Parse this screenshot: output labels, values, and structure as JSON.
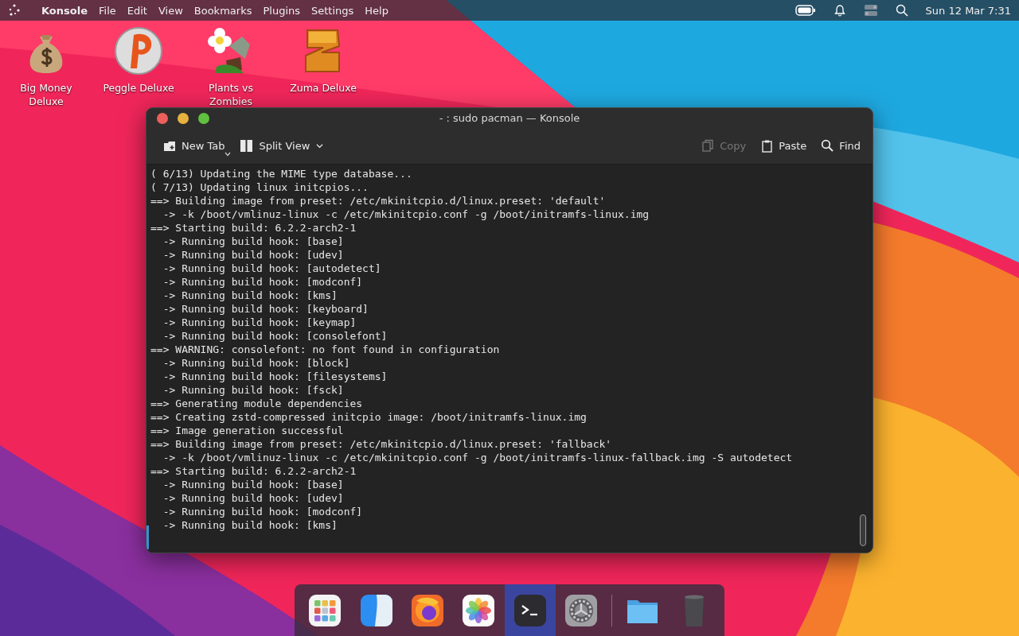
{
  "menu_bar": {
    "app_name": "Konsole",
    "menus": [
      "File",
      "Edit",
      "View",
      "Bookmarks",
      "Plugins",
      "Settings",
      "Help"
    ],
    "clock": "Sun 12 Mar 7:31"
  },
  "desktop_icons": [
    {
      "kind": "moneybag",
      "label": "Big Money Deluxe"
    },
    {
      "kind": "orb",
      "label": "Peggle Deluxe"
    },
    {
      "kind": "flower",
      "label": "Plants vs Zombies"
    },
    {
      "kind": "block",
      "label": "Zuma Deluxe"
    }
  ],
  "window": {
    "title": "- : sudo pacman — Konsole",
    "toolbar": [
      {
        "kind": "new-tab",
        "label": "New Tab",
        "disabled": false
      },
      {
        "kind": "split",
        "label": "Split View",
        "disabled": false
      },
      {
        "kind": "copy",
        "label": "Copy",
        "disabled": true
      },
      {
        "kind": "paste",
        "label": "Paste",
        "disabled": false
      },
      {
        "kind": "find",
        "label": "Find",
        "disabled": false
      }
    ],
    "terminal_lines": [
      "( 6/13) Updating the MIME type database...",
      "( 7/13) Updating linux initcpios...",
      "==> Building image from preset: /etc/mkinitcpio.d/linux.preset: 'default'",
      "  -> -k /boot/vmlinuz-linux -c /etc/mkinitcpio.conf -g /boot/initramfs-linux.img",
      "==> Starting build: 6.2.2-arch2-1",
      "  -> Running build hook: [base]",
      "  -> Running build hook: [udev]",
      "  -> Running build hook: [autodetect]",
      "  -> Running build hook: [modconf]",
      "  -> Running build hook: [kms]",
      "  -> Running build hook: [keyboard]",
      "  -> Running build hook: [keymap]",
      "  -> Running build hook: [consolefont]",
      "==> WARNING: consolefont: no font found in configuration",
      "  -> Running build hook: [block]",
      "  -> Running build hook: [filesystems]",
      "  -> Running build hook: [fsck]",
      "==> Generating module dependencies",
      "==> Creating zstd-compressed initcpio image: /boot/initramfs-linux.img",
      "==> Image generation successful",
      "==> Building image from preset: /etc/mkinitcpio.d/linux.preset: 'fallback'",
      "  -> -k /boot/vmlinuz-linux -c /etc/mkinitcpio.conf -g /boot/initramfs-linux-fallback.img -S autodetect",
      "==> Starting build: 6.2.2-arch2-1",
      "  -> Running build hook: [base]",
      "  -> Running build hook: [udev]",
      "  -> Running build hook: [modconf]",
      "  -> Running build hook: [kms]"
    ]
  },
  "dock": {
    "items": [
      {
        "kind": "grid",
        "selected": false
      },
      {
        "kind": "finder",
        "selected": false
      },
      {
        "kind": "browser",
        "selected": false
      },
      {
        "kind": "photos",
        "selected": false
      },
      {
        "kind": "terminal",
        "selected": true
      },
      {
        "kind": "settings",
        "selected": false
      },
      {
        "kind": "separator",
        "selected": false
      },
      {
        "kind": "folder",
        "selected": false
      },
      {
        "kind": "trash",
        "selected": false
      }
    ]
  }
}
